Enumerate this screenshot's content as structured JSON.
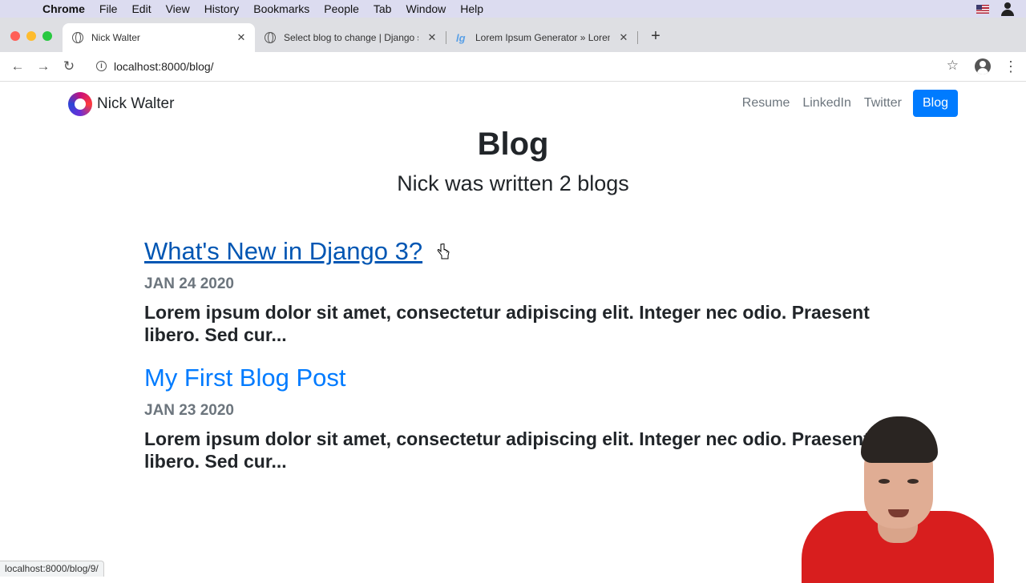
{
  "menubar": {
    "app": "Chrome",
    "items": [
      "File",
      "Edit",
      "View",
      "History",
      "Bookmarks",
      "People",
      "Tab",
      "Window",
      "Help"
    ]
  },
  "tabs": [
    {
      "title": "Nick Walter",
      "icon": "globe-icon",
      "active": true
    },
    {
      "title": "Select blog to change | Django s",
      "icon": "globe-icon",
      "active": false
    },
    {
      "title": "Lorem Ipsum Generator » Lorem",
      "icon": "lorem-ipsum-icon",
      "active": false
    }
  ],
  "toolbar": {
    "url": "localhost:8000/blog/"
  },
  "site": {
    "brand": "Nick Walter",
    "nav": [
      "Resume",
      "LinkedIn",
      "Twitter",
      "Blog"
    ],
    "heading": "Blog",
    "subheading": "Nick was written 2 blogs",
    "posts": [
      {
        "title": "What's New in Django 3?",
        "date": "JAN 24 2020",
        "excerpt": "Lorem ipsum dolor sit amet, consectetur adipiscing elit. Integer nec odio. Praesent libero. Sed cur..."
      },
      {
        "title": "My First Blog Post",
        "date": "JAN 23 2020",
        "excerpt": "Lorem ipsum dolor sit amet, consectetur adipiscing elit. Integer nec odio. Praesent libero. Sed cur..."
      }
    ]
  },
  "status_bar": "localhost:8000/blog/9/",
  "colors": {
    "nav_active": "#007bff",
    "link": "#007bff",
    "link_hover": "#0056b3"
  }
}
